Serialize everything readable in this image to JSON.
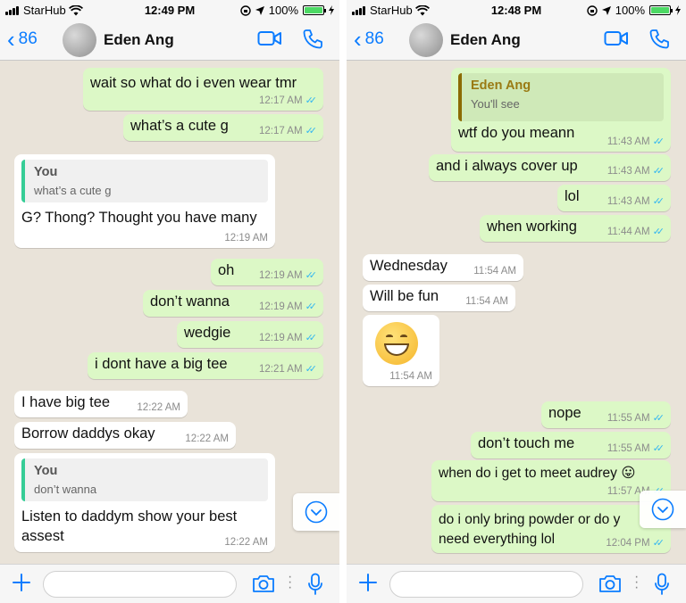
{
  "colors": {
    "accent": "#0a7cff",
    "outgoing_bubble": "#dcf8c6",
    "incoming_bubble": "#ffffff",
    "chat_bg": "#e9e3d9",
    "read_ticks": "#34b7f1"
  },
  "icons": [
    "signal-icon",
    "wifi-icon",
    "orientation-lock-icon",
    "location-icon",
    "battery-icon",
    "charging-icon",
    "chevron-left-icon",
    "video-call-icon",
    "phone-call-icon",
    "scroll-down-icon",
    "plus-icon",
    "camera-icon",
    "microphone-icon"
  ],
  "screens": [
    {
      "status": {
        "carrier": "StarHub",
        "time": "12:49 PM",
        "battery": "100%",
        "battery_level": 1.0
      },
      "header": {
        "back_count": "86",
        "contact_name": "Eden Ang"
      },
      "input_placeholder": "",
      "messages": [
        {
          "dir": "out",
          "text": "wait so what do i even wear tmr",
          "time": "12:17 AM",
          "read": true
        },
        {
          "dir": "out",
          "text": "what’s a cute g",
          "time": "12:17 AM",
          "read": true
        },
        {
          "dir": "in",
          "quote_name": "You",
          "quote_text": "what’s a cute g",
          "text": "G? Thong? Thought you have many",
          "time": "12:19 AM"
        },
        {
          "dir": "out",
          "text": "oh",
          "time": "12:19 AM",
          "read": true
        },
        {
          "dir": "out",
          "text": "don’t wanna",
          "time": "12:19 AM",
          "read": true
        },
        {
          "dir": "out",
          "text": "wedgie",
          "time": "12:19 AM",
          "read": true
        },
        {
          "dir": "out",
          "text": "i dont have a big tee",
          "time": "12:21 AM",
          "read": true
        },
        {
          "dir": "in",
          "text": "I have big tee",
          "time": "12:22 AM"
        },
        {
          "dir": "in",
          "text": "Borrow daddys okay",
          "time": "12:22 AM"
        },
        {
          "dir": "in",
          "quote_name": "You",
          "quote_text": "don’t wanna",
          "text": "Listen to daddym show your best\nassest",
          "time": "12:22 AM"
        }
      ]
    },
    {
      "status": {
        "carrier": "StarHub",
        "time": "12:48 PM",
        "battery": "100%",
        "battery_level": 1.0
      },
      "header": {
        "back_count": "86",
        "contact_name": "Eden Ang"
      },
      "input_placeholder": "",
      "messages": [
        {
          "dir": "out",
          "quote_name": "Eden Ang",
          "quote_text": "You'll see",
          "text": "wtf do you meann",
          "time": "11:43 AM",
          "read": true
        },
        {
          "dir": "out",
          "text": "and i always cover up",
          "time": "11:43 AM",
          "read": true
        },
        {
          "dir": "out",
          "text": "lol",
          "time": "11:43 AM",
          "read": true
        },
        {
          "dir": "out",
          "text": "when working",
          "time": "11:44 AM",
          "read": true
        },
        {
          "dir": "in",
          "text": "Wednesday",
          "time": "11:54 AM"
        },
        {
          "dir": "in",
          "text": "Will be fun",
          "time": "11:54 AM"
        },
        {
          "dir": "in",
          "emoji": "grinning-face",
          "text": "",
          "time": "11:54 AM"
        },
        {
          "dir": "out",
          "text": "nope",
          "time": "11:55 AM",
          "read": true
        },
        {
          "dir": "out",
          "text": "don’t touch me",
          "time": "11:55 AM",
          "read": true
        },
        {
          "dir": "out",
          "text": "when do i get to meet audrey 😛",
          "time": "11:57 AM",
          "read": true
        },
        {
          "dir": "out",
          "text": "do i only bring powder or do y\nneed everything lol",
          "time": "12:04 PM",
          "read": true
        }
      ]
    }
  ]
}
